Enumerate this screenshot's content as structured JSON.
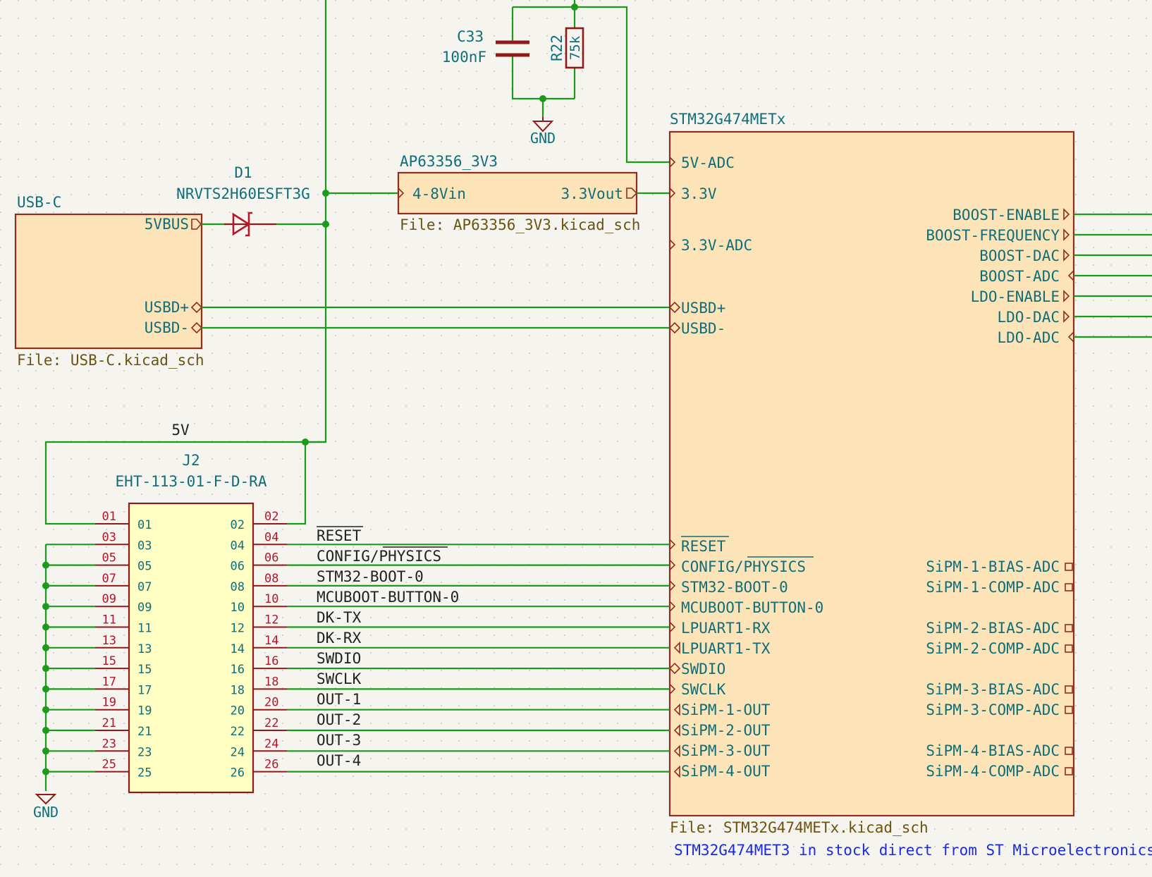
{
  "components": {
    "c33": {
      "ref": "C33",
      "value": "100nF"
    },
    "r22": {
      "ref": "R22",
      "value": "75k"
    },
    "d1": {
      "ref": "D1",
      "value": "NRVTS2H60ESFT3G"
    },
    "gnd_top": "GND",
    "gnd_bottom": "GND",
    "j2": {
      "ref": "J2",
      "value": "EHT-113-01-F-D-RA"
    },
    "net_5v": "5V"
  },
  "sheets": {
    "usbc": {
      "name": "USB-C",
      "file": "File: USB-C.kicad_sch",
      "pins": [
        "5VBUS",
        "USBD+",
        "USBD-"
      ]
    },
    "ap": {
      "name": "AP63356_3V3",
      "file": "File: AP63356_3V3.kicad_sch",
      "pin_in": "4-8Vin",
      "pin_out": "3.3Vout"
    },
    "stm": {
      "name": "STM32G474METx",
      "file": "File: STM32G474METx.kicad_sch",
      "left_pins_top": [
        "5V-ADC",
        "3.3V",
        "3.3V-ADC",
        "USBD+",
        "USBD-"
      ],
      "left_pins_bottom": [
        "RESET",
        "CONFIG/PHYSICS",
        "STM32-BOOT-0",
        "MCUBOOT-BUTTON-0",
        "LPUART1-RX",
        "LPUART1-TX",
        "SWDIO",
        "SWCLK",
        "SiPM-1-OUT",
        "SiPM-2-OUT",
        "SiPM-3-OUT",
        "SiPM-4-OUT"
      ],
      "right_pins_top": [
        "BOOST-ENABLE",
        "BOOST-FREQUENCY",
        "BOOST-DAC",
        "BOOST-ADC",
        "LDO-ENABLE",
        "LDO-DAC",
        "LDO-ADC"
      ],
      "right_pins_bottom": [
        "SiPM-1-BIAS-ADC",
        "SiPM-1-COMP-ADC",
        "SiPM-2-BIAS-ADC",
        "SiPM-2-COMP-ADC",
        "SiPM-3-BIAS-ADC",
        "SiPM-3-COMP-ADC",
        "SiPM-4-BIAS-ADC",
        "SiPM-4-COMP-ADC"
      ]
    }
  },
  "connector": {
    "odd_pins": [
      "01",
      "03",
      "05",
      "07",
      "09",
      "11",
      "13",
      "15",
      "17",
      "19",
      "21",
      "23",
      "25"
    ],
    "even_pins": [
      "02",
      "04",
      "06",
      "08",
      "10",
      "12",
      "14",
      "16",
      "18",
      "20",
      "22",
      "24",
      "26"
    ],
    "net_labels": [
      "RESET",
      "CONFIG/PHYSICS",
      "STM32-BOOT-0",
      "MCUBOOT-BUTTON-0",
      "DK-TX",
      "DK-RX",
      "SWDIO",
      "SWCLK",
      "OUT-1",
      "OUT-2",
      "OUT-3",
      "OUT-4"
    ]
  },
  "note": "STM32G474MET3 in stock direct from ST Microelectronics.",
  "colors": {
    "wire": "#1c9a1c",
    "sheet_fill": "#fde3b8",
    "chip_fill": "#ffffc3",
    "text_teal": "#0e6f7a",
    "note_blue": "#1a2ae0"
  }
}
